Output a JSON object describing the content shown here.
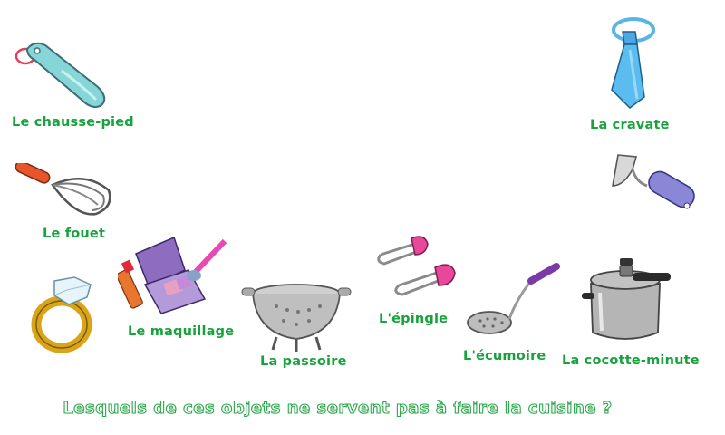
{
  "items": [
    {
      "id": "chausse-pied",
      "label": "Le chausse-pied",
      "icon": "shoehorn-icon"
    },
    {
      "id": "fouet",
      "label": "Le fouet",
      "icon": "whisk-icon"
    },
    {
      "id": "bague",
      "label": "",
      "icon": "diamond-ring-icon"
    },
    {
      "id": "maquillage",
      "label": "Le maquillage",
      "icon": "makeup-icon"
    },
    {
      "id": "passoire",
      "label": "La passoire",
      "icon": "colander-icon"
    },
    {
      "id": "epingle",
      "label": "L'épingle",
      "icon": "safety-pin-icon"
    },
    {
      "id": "ecumoire",
      "label": "L'écumoire",
      "icon": "skimmer-icon"
    },
    {
      "id": "cocotte",
      "label": "La cocotte-minute",
      "icon": "pressure-cooker-icon"
    },
    {
      "id": "cravate",
      "label": "La cravate",
      "icon": "tie-icon"
    },
    {
      "id": "eplucheur",
      "label": "",
      "icon": "peeler-icon"
    }
  ],
  "question": "Lesquels de ces objets ne servent pas à faire la cuisine ?",
  "colors": {
    "label": "#17a33c",
    "question_outline": "#2aa84a"
  }
}
